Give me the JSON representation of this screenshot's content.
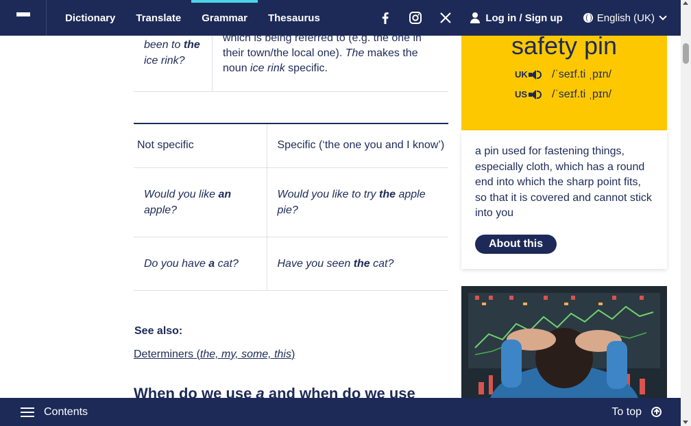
{
  "nav": {
    "links": [
      "Dictionary",
      "Translate",
      "Grammar",
      "Thesaurus"
    ],
    "active": "Grammar",
    "login_label": "Log in / Sign up",
    "language": "English (UK)",
    "social_icons": [
      "facebook-icon",
      "instagram-icon",
      "x-icon"
    ]
  },
  "top_row": {
    "left_pre": "been to ",
    "left_bold": "the",
    "left_post": " ice rink?",
    "right_text_1": "which is being referred to (e.g. the one in their town/the local one). ",
    "right_italic_1": "The",
    "right_text_2": " makes the noun ",
    "right_italic_2": "ice rink",
    "right_text_3": " specific."
  },
  "table": {
    "headers": [
      "Not specific",
      "Specific (‘the one you and I know’)"
    ],
    "rows": [
      {
        "c1_pre": "Would you like ",
        "c1_bold": "an",
        "c1_post": " apple?",
        "c2_pre": "Would you like to try ",
        "c2_bold": "the",
        "c2_post": " apple pie?"
      },
      {
        "c1_pre": "Do you have ",
        "c1_bold": "a",
        "c1_post": " cat?",
        "c2_pre": "Have you seen ",
        "c2_bold": "the",
        "c2_post": " cat?"
      }
    ]
  },
  "see_also": {
    "label": "See also:",
    "link_pre": "Determiners (",
    "link_italic": "the, my, some, this",
    "link_post": ")"
  },
  "subheading": {
    "pre": "When do we use ",
    "italic": "a",
    "post": " and when do we use"
  },
  "word_of_day": {
    "word": "safety pin",
    "uk_label": "UK",
    "uk_ipa": "/ˈseɪf.ti ˌpɪn/",
    "us_label": "US",
    "us_ipa": "/ˈseɪf.ti ˌpɪn/",
    "definition": "a pin used for fastening things, especially cloth, which has a round end into which the sharp point fits, so that it is covered and cannot stick into you",
    "button": "About this"
  },
  "bottom": {
    "contents_label": "Contents",
    "totop_label": "To top"
  },
  "colors": {
    "navy": "#1d2a57",
    "yellow": "#fec801",
    "accent": "#4fd1e8"
  }
}
